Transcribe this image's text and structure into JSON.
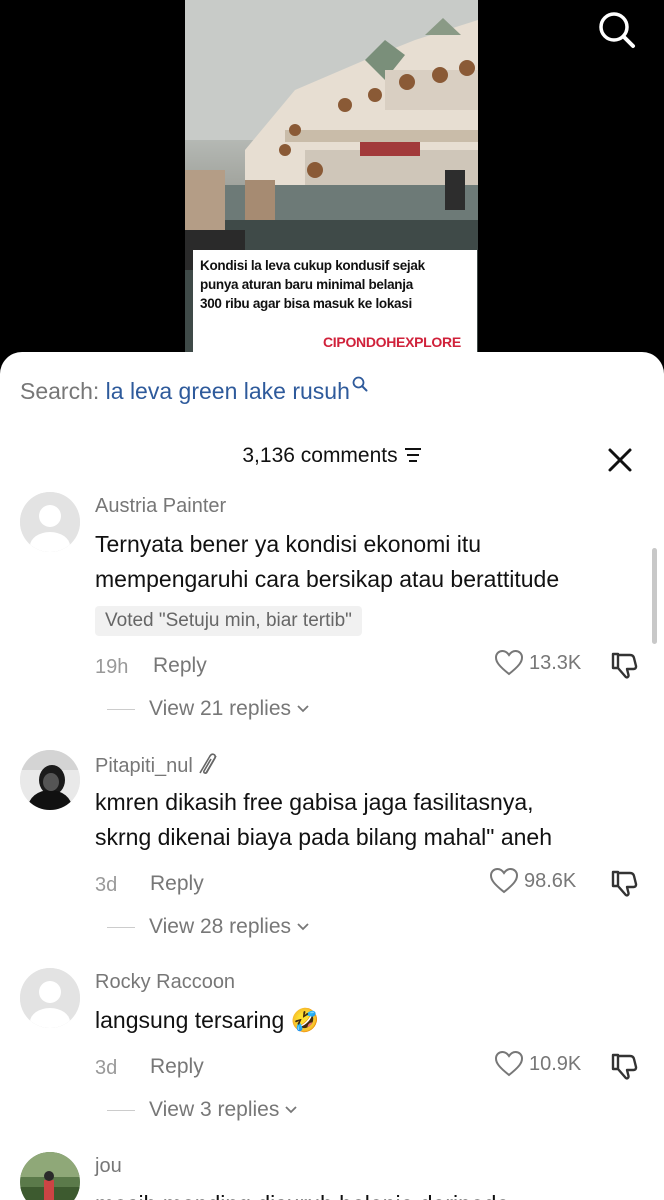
{
  "video": {
    "caption_lines": [
      "Kondisi la leva cukup kondusif sejak",
      "punya aturan baru minimal belanja",
      "300 ribu agar bisa masuk ke lokasi"
    ],
    "brand": "CIPONDOHEXPLORE"
  },
  "search": {
    "label": "Search:",
    "term": "la leva green lake rusuh"
  },
  "comments_header": {
    "count_label": "3,136 comments"
  },
  "comments": [
    {
      "username": "Austria Painter",
      "lines": [
        "Ternyata bener ya kondisi ekonomi itu",
        "mempengaruhi cara bersikap atau berattitude"
      ],
      "vote": "Voted \"Setuju min, biar tertib\"",
      "time": "19h",
      "reply_label": "Reply",
      "likes": "13.3K",
      "view_replies": "View 21 replies"
    },
    {
      "username": "Pitapiti_nul",
      "lines": [
        "kmren dikasih free gabisa jaga fasilitasnya,",
        "skrng dikenai biaya pada bilang mahal\" aneh"
      ],
      "time": "3d",
      "reply_label": "Reply",
      "likes": "98.6K",
      "view_replies": "View 28 replies"
    },
    {
      "username": "Rocky Raccoon",
      "lines": [
        "langsung tersaring 🤣"
      ],
      "time": "3d",
      "reply_label": "Reply",
      "likes": "10.9K",
      "view_replies": "View 3 replies"
    },
    {
      "username": "jou",
      "lines": [
        "masih mending disuruh belanja daripada"
      ]
    }
  ]
}
